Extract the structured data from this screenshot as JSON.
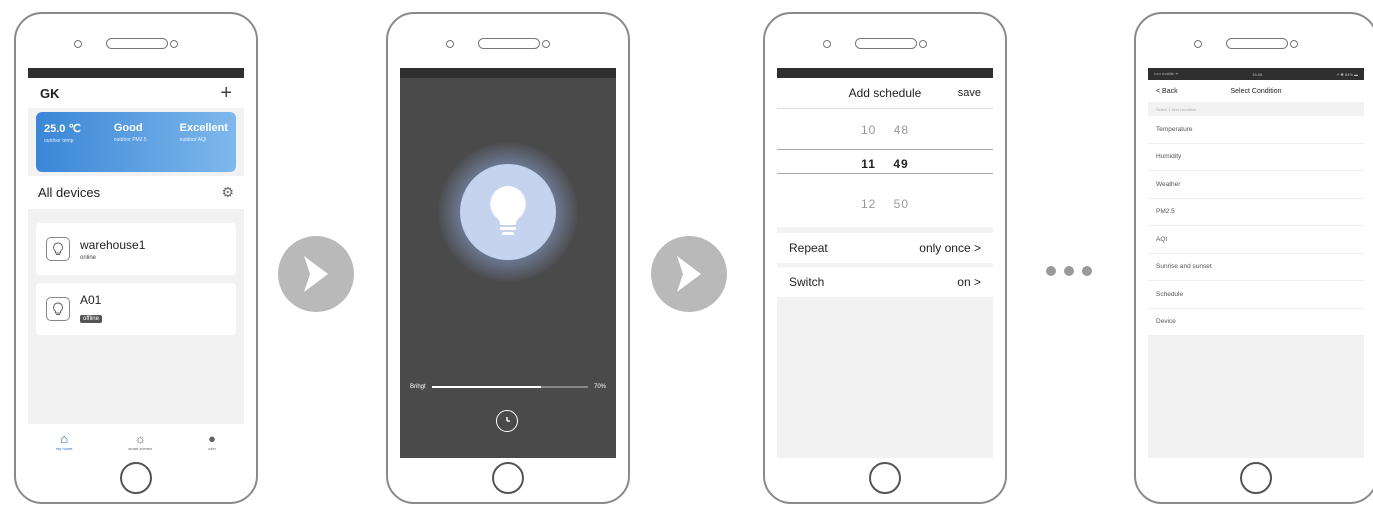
{
  "phone1": {
    "header_title": "GK",
    "header_plus": "+",
    "weather": [
      {
        "value": "25.0 ℃",
        "label": "outdoor temp"
      },
      {
        "value": "Good",
        "label": "outdoor PM2.5"
      },
      {
        "value": "Excellent",
        "label": "outdoor AQI"
      }
    ],
    "all_devices_label": "All devices",
    "devices": [
      {
        "name": "warehouse1",
        "status": "online"
      },
      {
        "name": "A01",
        "status": "offline"
      }
    ],
    "tabs": [
      {
        "label": "my home",
        "icon": "home-icon"
      },
      {
        "label": "smart scenes",
        "icon": "sun-icon"
      },
      {
        "label": "user",
        "icon": "user-icon"
      }
    ]
  },
  "phone2": {
    "brightness_label": "Brihgt",
    "brightness_value": "70%",
    "brightness_fraction": 0.7
  },
  "phone3": {
    "title": "Add schedule",
    "save_label": "save",
    "picker": [
      {
        "hour": "10",
        "minute": "48"
      },
      {
        "hour": "11",
        "minute": "49"
      },
      {
        "hour": "12",
        "minute": "50"
      }
    ],
    "repeat_label": "Repeat",
    "repeat_value": "only once >",
    "switch_label": "Switch",
    "switch_value": "on >"
  },
  "phone4": {
    "status_carrier": "••••• mobile ᯤ",
    "status_time": "16:06",
    "status_right": "↗ ✱ 84% ▬",
    "back_label": "< Back",
    "title": "Select Condition",
    "hint": "Select 1 kind condition",
    "conditions": [
      "Temperature",
      "Humidity",
      "Weather",
      "PM2.5",
      "AQI",
      "Sunrise and sunset",
      "Schedule",
      "Device"
    ]
  }
}
